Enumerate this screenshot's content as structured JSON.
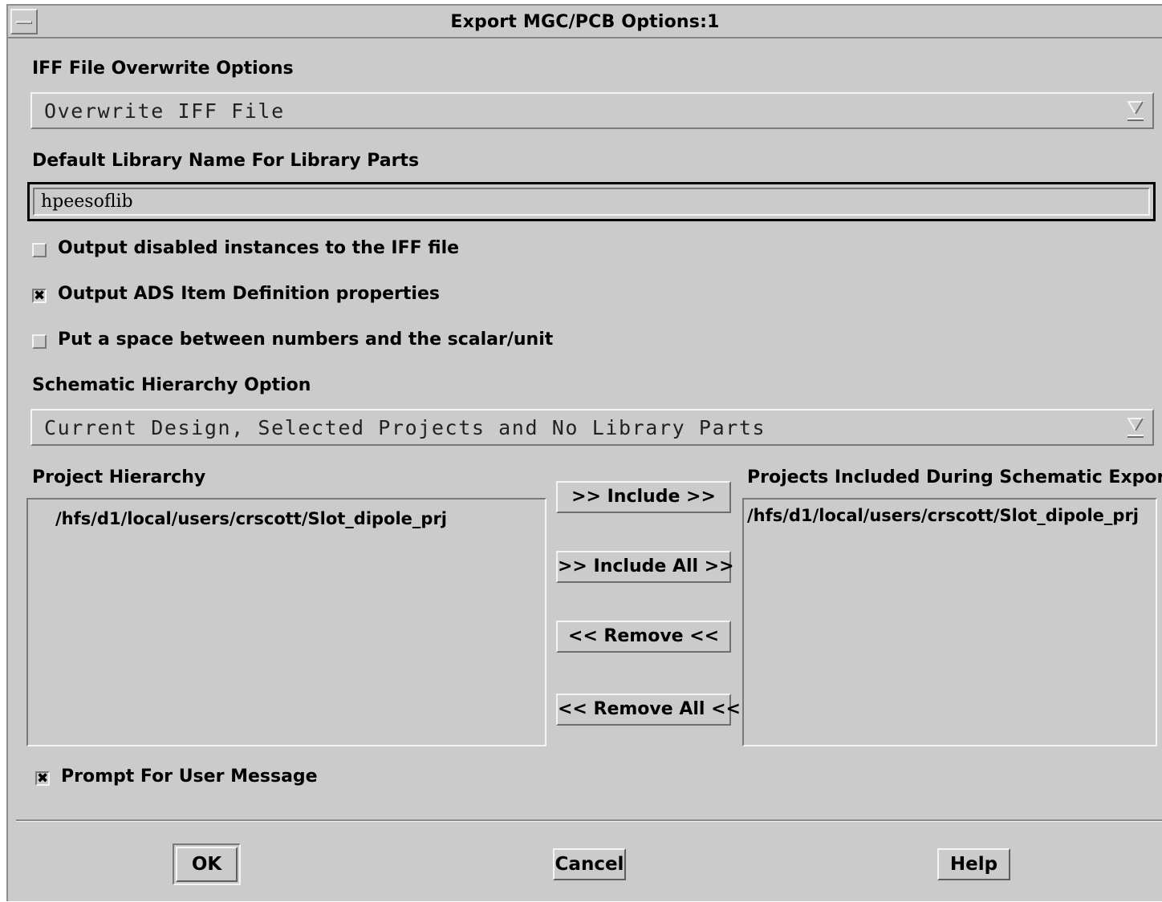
{
  "window": {
    "title": "Export MGC/PCB Options:1"
  },
  "iff": {
    "label": "IFF File Overwrite Options",
    "selected": "Overwrite IFF File"
  },
  "library": {
    "label": "Default Library Name For Library Parts",
    "value": "hpeesoflib"
  },
  "options": [
    {
      "label": "Output disabled instances to the IFF file",
      "checked": false
    },
    {
      "label": "Output ADS Item Definition properties",
      "checked": true
    },
    {
      "label": "Put a space between numbers and the scalar/unit",
      "checked": false
    }
  ],
  "hierarchy": {
    "label": "Schematic Hierarchy Option",
    "selected": "Current Design, Selected Projects and No Library Parts"
  },
  "project_hierarchy": {
    "label": "Project Hierarchy",
    "items": [
      "/hfs/d1/local/users/crscott/Slot_dipole_prj"
    ]
  },
  "projects_included": {
    "label": "Projects Included During Schematic Export",
    "items": [
      "/hfs/d1/local/users/crscott/Slot_dipole_prj"
    ]
  },
  "transfer_buttons": {
    "include": ">> Include >>",
    "include_all": ">> Include All >>",
    "remove": "<< Remove <<",
    "remove_all": "<< Remove All <<"
  },
  "prompt": {
    "label": "Prompt For User Message",
    "checked": true
  },
  "buttons": {
    "ok": "OK",
    "cancel": "Cancel",
    "help": "Help"
  },
  "check_mark": "✖"
}
